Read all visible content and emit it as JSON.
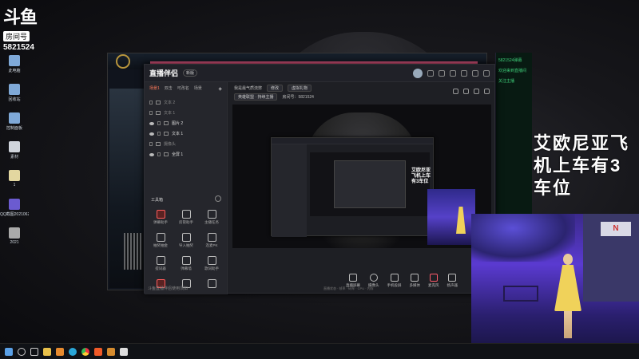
{
  "watermark": {
    "logo": "斗鱼",
    "room_label": "房间号",
    "room_number": "5821524"
  },
  "desktop_icons": [
    "此电脑",
    "回收站",
    "控制面板",
    "素材",
    "1",
    "QQ截图20210622...",
    "2021"
  ],
  "app": {
    "brand": "直播伴侣",
    "version_badge": "新版",
    "side_tabs": [
      "场景1",
      "双击",
      "可改名",
      "场景"
    ],
    "layers": [
      "文本 2",
      "文本 1",
      "图片 2",
      "文本 1",
      "摄像头",
      "全屏 1"
    ],
    "tools_title": "工具箱",
    "tools": [
      "弹幕助手",
      "房管助手",
      "主播任务",
      "抽奖抽金",
      "导入抽奖",
      "连麦PK",
      "提词器",
      "弹幕墙",
      "歌词助手",
      "",
      "",
      ""
    ],
    "notice": "斗鱼直播伴侣使用须知",
    "stream_title": "我是最气质流弊",
    "header_pill": "修改",
    "header_btn": "虚拟礼物",
    "category": "英雄联盟 · 持续主播",
    "room_no": "房间号：5821524",
    "controls": [
      "直播屏幕",
      "摄像头",
      "手机投屏",
      "多媒体",
      "麦克风",
      "扬声器"
    ],
    "status": "直播状态 · 帧率 · 码率 · CPU · 内存"
  },
  "overlay_caption": "艾欧尼亚飞机上车有3车位",
  "mini_caption": "艾欧尼亚飞机上车有3车位",
  "street_sign": "N",
  "taskbar_icons": [
    "windows-icon",
    "search-icon",
    "task-view-icon",
    "folder-icon",
    "edge-icon",
    "chrome-icon",
    "douyu-icon",
    "obs-icon",
    "app-icon"
  ]
}
